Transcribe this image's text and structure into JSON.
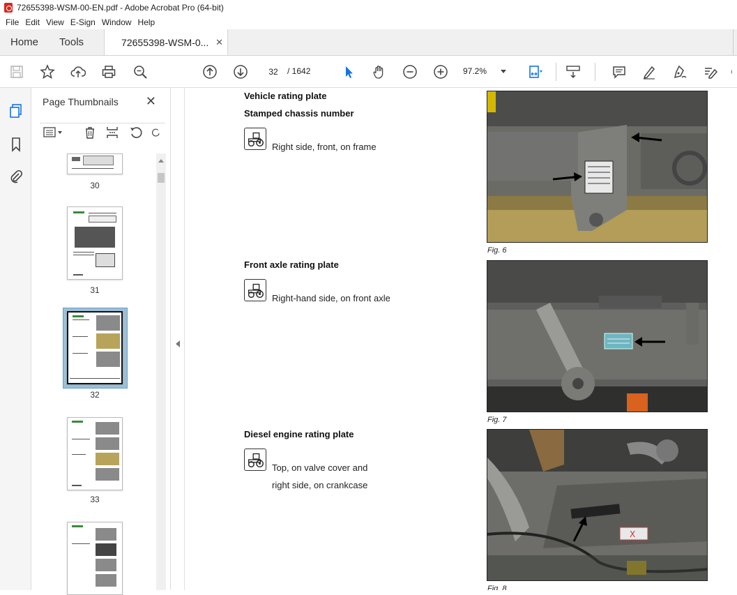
{
  "window": {
    "title": "72655398-WSM-00-EN.pdf - Adobe Acrobat Pro (64-bit)"
  },
  "menu": [
    "File",
    "Edit",
    "View",
    "E-Sign",
    "Window",
    "Help"
  ],
  "tabs": {
    "home": "Home",
    "tools": "Tools",
    "document": "72655398-WSM-0...",
    "close": "✕"
  },
  "toolbar": {
    "page_current": "32",
    "page_total": "/ 1642",
    "zoom": "97.2%"
  },
  "thumbnails": {
    "title": "Page Thumbnails",
    "close": "✕",
    "pages": [
      {
        "label": "30"
      },
      {
        "label": "31"
      },
      {
        "label": "32",
        "selected": true
      },
      {
        "label": "33"
      }
    ]
  },
  "document": {
    "sections": [
      {
        "heading": "Vehicle rating plate",
        "subheading": "Stamped chassis number",
        "desc_lines": [
          "Right side, front, on frame"
        ],
        "caption": "Fig. 6"
      },
      {
        "heading": "Front axle rating plate",
        "desc_lines": [
          "Right-hand side, on front axle"
        ],
        "caption": "Fig. 7"
      },
      {
        "heading": "Diesel engine rating plate",
        "desc_lines": [
          "Top, on valve cover and",
          "right side, on crankcase"
        ],
        "caption": "Fig. 8"
      }
    ]
  },
  "colors": {
    "accent": "#1473e6",
    "selection": "#9dbfd6",
    "pdf_red": "#d8281e"
  }
}
